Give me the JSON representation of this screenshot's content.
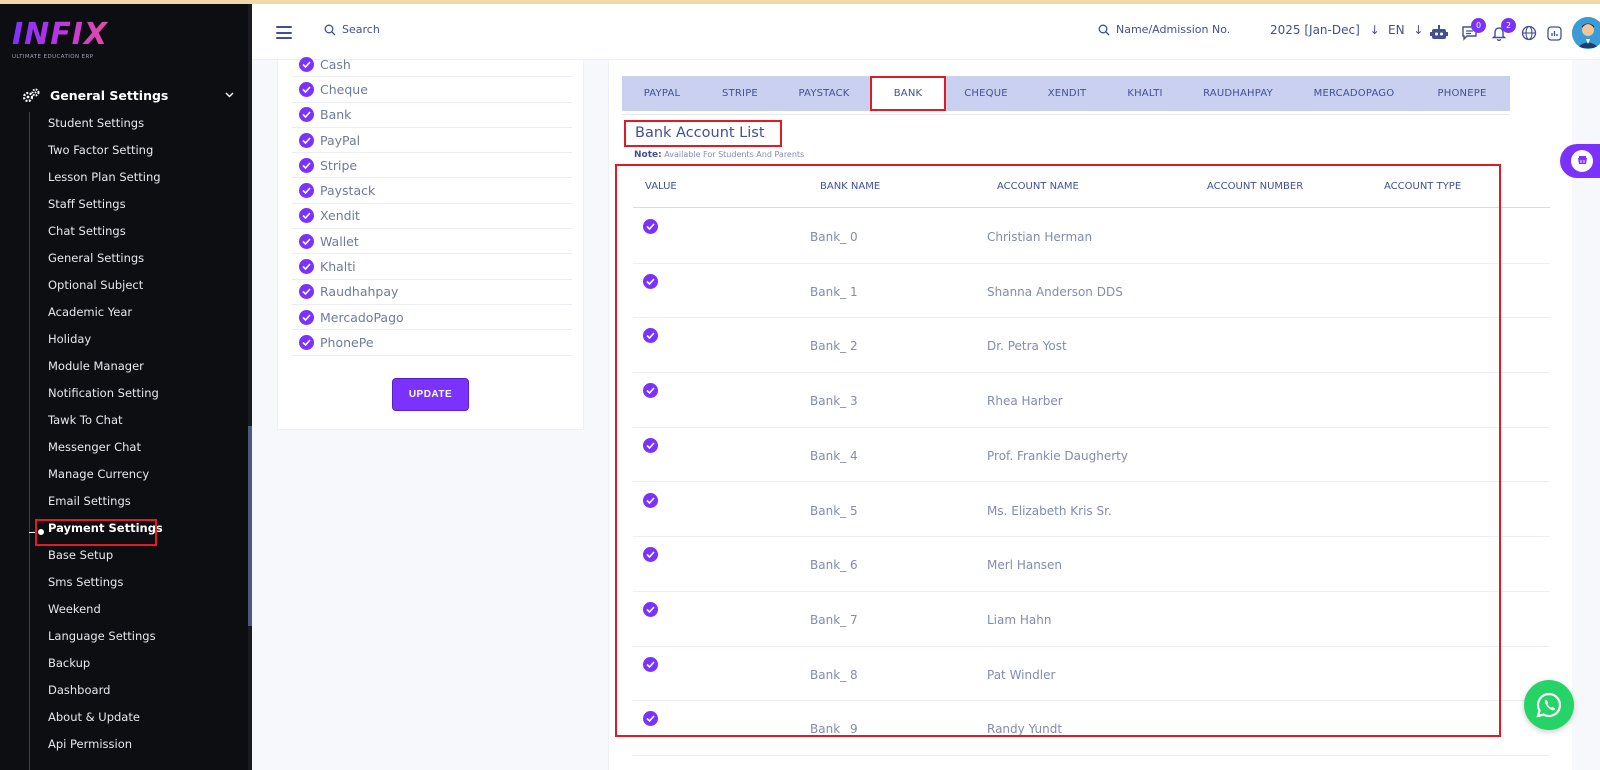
{
  "brand": {
    "name": "INFIX",
    "tagline": "ULTIMATE EDUCATION ERP"
  },
  "sidebar": {
    "group_label": "General Settings",
    "items": [
      {
        "label": "Student Settings"
      },
      {
        "label": "Two Factor Setting"
      },
      {
        "label": "Lesson Plan Setting"
      },
      {
        "label": "Staff Settings"
      },
      {
        "label": "Chat Settings"
      },
      {
        "label": "General Settings"
      },
      {
        "label": "Optional Subject"
      },
      {
        "label": "Academic Year"
      },
      {
        "label": "Holiday"
      },
      {
        "label": "Module Manager"
      },
      {
        "label": "Notification Setting"
      },
      {
        "label": "Tawk To Chat"
      },
      {
        "label": "Messenger Chat"
      },
      {
        "label": "Manage Currency"
      },
      {
        "label": "Email Settings"
      },
      {
        "label": "Payment Settings",
        "active": true
      },
      {
        "label": "Base Setup"
      },
      {
        "label": "Sms Settings"
      },
      {
        "label": "Weekend"
      },
      {
        "label": "Language Settings"
      },
      {
        "label": "Backup"
      },
      {
        "label": "Dashboard"
      },
      {
        "label": "About & Update"
      },
      {
        "label": "Api Permission"
      }
    ]
  },
  "header": {
    "search_label": "Search",
    "admission_search_label": "Name/Admission No.",
    "academic_year": "2025 [Jan-Dec]",
    "language": "EN",
    "chat_badge": "0",
    "notification_badge": "2"
  },
  "payment_methods": {
    "items": [
      {
        "label": "Cash"
      },
      {
        "label": "Cheque"
      },
      {
        "label": "Bank"
      },
      {
        "label": "PayPal"
      },
      {
        "label": "Stripe"
      },
      {
        "label": "Paystack"
      },
      {
        "label": "Xendit"
      },
      {
        "label": "Wallet"
      },
      {
        "label": "Khalti"
      },
      {
        "label": "Raudhahpay"
      },
      {
        "label": "MercadoPago"
      },
      {
        "label": "PhonePe"
      }
    ],
    "update_label": "UPDATE"
  },
  "gateway_tabs": [
    {
      "label": "PAYPAL"
    },
    {
      "label": "STRIPE"
    },
    {
      "label": "PAYSTACK"
    },
    {
      "label": "BANK",
      "active": true
    },
    {
      "label": "CHEQUE"
    },
    {
      "label": "XENDIT"
    },
    {
      "label": "KHALTI"
    },
    {
      "label": "RAUDHAHPAY"
    },
    {
      "label": "MERCADOPAGO"
    },
    {
      "label": "PHONEPE"
    }
  ],
  "bank_list": {
    "title": "Bank Account List",
    "note_label": "Note:",
    "note_text": "Available For Students And Parents",
    "columns": [
      "VALUE",
      "BANK NAME",
      "ACCOUNT NAME",
      "ACCOUNT NUMBER",
      "ACCOUNT TYPE"
    ],
    "rows": [
      {
        "bank_name": "Bank_ 0",
        "account_name": "Christian Herman"
      },
      {
        "bank_name": "Bank_ 1",
        "account_name": "Shanna Anderson DDS"
      },
      {
        "bank_name": "Bank_ 2",
        "account_name": "Dr. Petra Yost"
      },
      {
        "bank_name": "Bank_ 3",
        "account_name": "Rhea Harber"
      },
      {
        "bank_name": "Bank_ 4",
        "account_name": "Prof. Frankie Daugherty"
      },
      {
        "bank_name": "Bank_ 5",
        "account_name": "Ms. Elizabeth Kris Sr."
      },
      {
        "bank_name": "Bank_ 6",
        "account_name": "Merl Hansen"
      },
      {
        "bank_name": "Bank_ 7",
        "account_name": "Liam Hahn"
      },
      {
        "bank_name": "Bank_ 8",
        "account_name": "Pat Windler"
      },
      {
        "bank_name": "Bank_ 9",
        "account_name": "Randy Yundt"
      }
    ]
  },
  "colors": {
    "accent": "#7c32ff",
    "highlight": "#e01b24",
    "sidebar_bg": "#0d0e12",
    "whatsapp": "#25d366"
  }
}
